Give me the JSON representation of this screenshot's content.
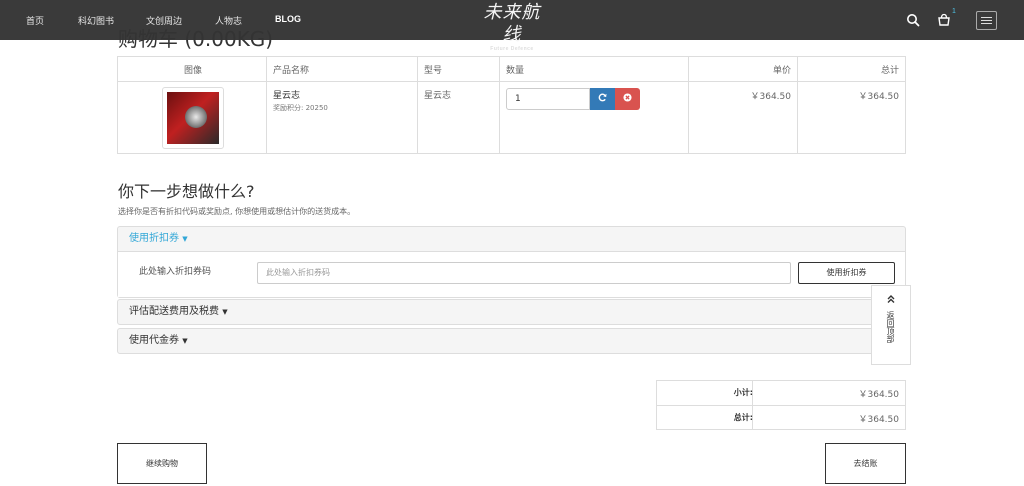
{
  "nav": {
    "links": [
      "首页",
      "科幻图书",
      "文创周边",
      "人物志",
      "BLOG"
    ],
    "logo_text": "未来航线",
    "logo_sub": "Future Defence",
    "cart_count": "1",
    "icons": [
      "search-icon",
      "cart-icon",
      "menu-icon"
    ]
  },
  "page_title": "购物车 (0.00KG)",
  "cart": {
    "headers": [
      "图像",
      "产品名称",
      "型号",
      "数量",
      "单价",
      "总计"
    ],
    "items": [
      {
        "name": "星云志",
        "reward": "奖励积分: 20250",
        "model": "星云志",
        "quantity": "1",
        "unit_price": "￥364.50",
        "total": "￥364.50"
      }
    ]
  },
  "next_step": {
    "title": "你下一步想做什么?",
    "description": "选择你是否有折扣代码或奖励点, 你想使用或想估计你的送货成本。"
  },
  "panels": {
    "coupon": {
      "title": "使用折扣券",
      "label": "此处输入折扣券码",
      "placeholder": "此处输入折扣券码",
      "button": "使用折扣券"
    },
    "shipping": {
      "title": "评估配送费用及税费"
    },
    "voucher": {
      "title": "使用代金券"
    }
  },
  "back_to_top": "返回顶部",
  "totals": [
    {
      "label": "小计:",
      "value": "￥364.50"
    },
    {
      "label": "总计:",
      "value": "￥364.50"
    }
  ],
  "buttons": {
    "continue": "继续购物",
    "checkout": "去结账"
  },
  "colors": {
    "nav_bg": "#3a3a3a",
    "accent": "#32a7d7",
    "refresh": "#337ab7",
    "remove": "#d9534f"
  }
}
